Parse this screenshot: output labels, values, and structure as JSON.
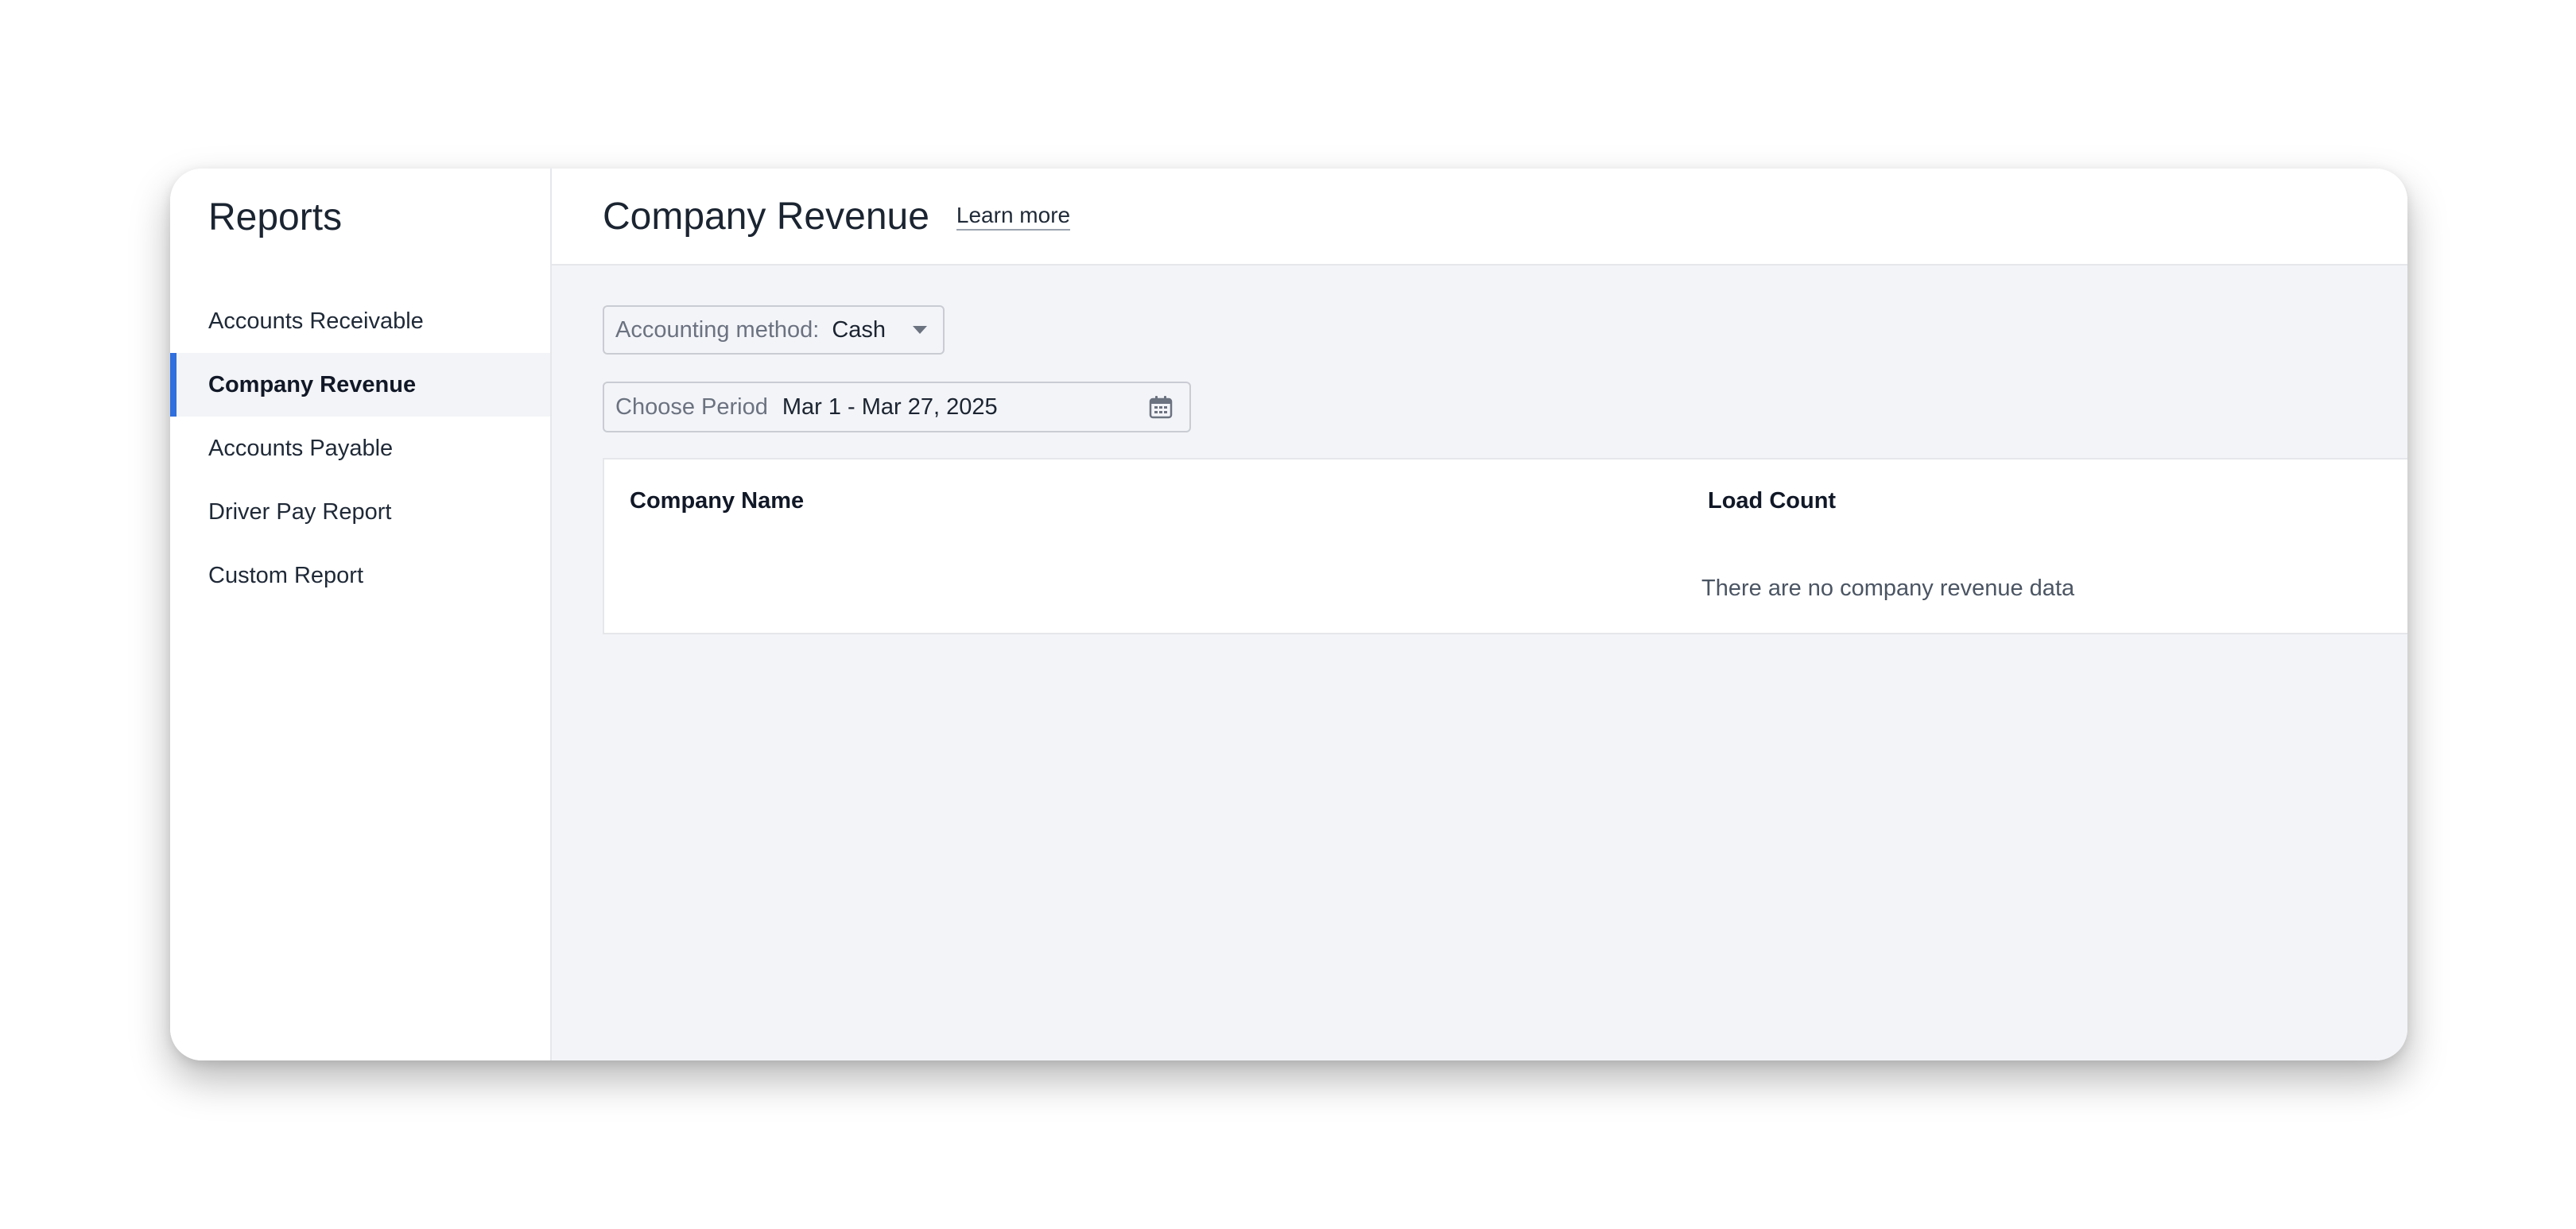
{
  "sidebar": {
    "title": "Reports",
    "items": [
      {
        "label": "Accounts Receivable",
        "active": false
      },
      {
        "label": "Company Revenue",
        "active": true
      },
      {
        "label": "Accounts Payable",
        "active": false
      },
      {
        "label": "Driver Pay Report",
        "active": false
      },
      {
        "label": "Custom Report",
        "active": false
      }
    ]
  },
  "header": {
    "title": "Company Revenue",
    "learn_more": "Learn more"
  },
  "filters": {
    "accounting_method": {
      "label": "Accounting method:",
      "value": "Cash",
      "icon": "chevron-down-icon"
    },
    "period": {
      "label": "Choose Period",
      "value": "Mar 1 - Mar 27, 2025",
      "icon": "calendar-icon"
    }
  },
  "table": {
    "columns": [
      "Company Name",
      "Load Count"
    ],
    "empty_message": "There are no company revenue data"
  },
  "colors": {
    "accent": "#2f6fde",
    "main_bg": "#f3f4f8",
    "active_item_bg": "#f3f4f7"
  }
}
